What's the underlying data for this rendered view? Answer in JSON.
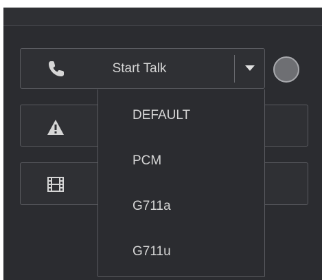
{
  "talk_control": {
    "label": "Start Talk",
    "icon": "phone-icon",
    "options": [
      "DEFAULT",
      "PCM",
      "G711a",
      "G711u"
    ]
  },
  "alarm_control": {
    "icon": "warning-icon"
  },
  "record_control": {
    "icon": "film-icon"
  },
  "colors": {
    "panel_bg": "#2b2c30",
    "border": "#5a5b60",
    "text": "#d6d6d6",
    "status_circle": "#6e6f73"
  }
}
